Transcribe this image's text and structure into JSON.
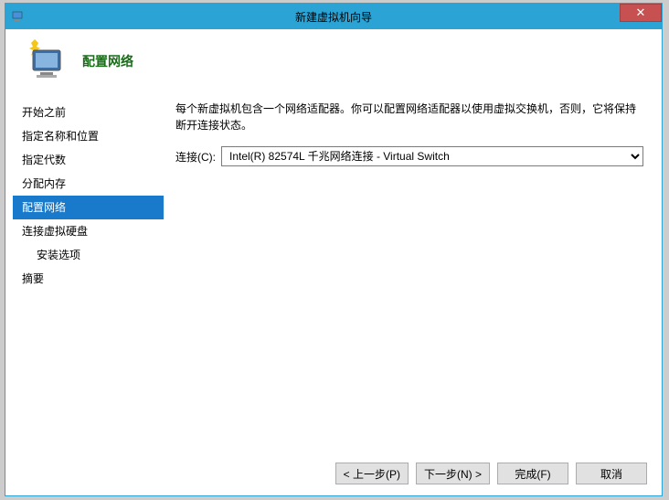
{
  "window": {
    "title": "新建虚拟机向导"
  },
  "header": {
    "title": "配置网络"
  },
  "sidebar": {
    "items": [
      {
        "label": "开始之前",
        "active": false,
        "indent": false
      },
      {
        "label": "指定名称和位置",
        "active": false,
        "indent": false
      },
      {
        "label": "指定代数",
        "active": false,
        "indent": false
      },
      {
        "label": "分配内存",
        "active": false,
        "indent": false
      },
      {
        "label": "配置网络",
        "active": true,
        "indent": false
      },
      {
        "label": "连接虚拟硬盘",
        "active": false,
        "indent": false
      },
      {
        "label": "安装选项",
        "active": false,
        "indent": true
      },
      {
        "label": "摘要",
        "active": false,
        "indent": false
      }
    ]
  },
  "main": {
    "description": "每个新虚拟机包含一个网络适配器。你可以配置网络适配器以使用虚拟交换机，否则，它将保持断开连接状态。",
    "connection_label": "连接(C):",
    "connection_value": "Intel(R) 82574L 千兆网络连接 - Virtual Switch"
  },
  "buttons": {
    "prev": "< 上一步(P)",
    "next": "下一步(N) >",
    "finish": "完成(F)",
    "cancel": "取消"
  }
}
